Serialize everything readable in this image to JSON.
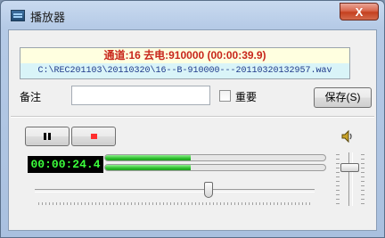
{
  "window": {
    "title": "播放器",
    "close_label": "X"
  },
  "info": {
    "channel_line": "通道:16 去电:910000 (00:00:39.9)",
    "file_path": "C:\\REC201103\\20110320\\16--B-910000---20110320132957.wav"
  },
  "note": {
    "label": "备注",
    "value": "",
    "placeholder": ""
  },
  "important": {
    "label": "重要",
    "checked": false
  },
  "save_button": "保存(S)",
  "playback": {
    "elapsed": "00:00:24.4",
    "level_left": 0.39,
    "level_right": 0.39,
    "position": 0.62,
    "volume": 0.72
  },
  "icons": {
    "app": "player-window-icon",
    "pause": "pause-icon",
    "stop": "stop-icon",
    "volume": "speaker-icon"
  },
  "colors": {
    "channel_text": "#c8271b",
    "path_text": "#1f3a8a",
    "channel_bg": "#ffffe0",
    "path_bg": "#d9f4f8",
    "time_text": "#3cff3c",
    "meter_fill": "#2fbf2f",
    "stop_icon": "#ff2e2e"
  }
}
